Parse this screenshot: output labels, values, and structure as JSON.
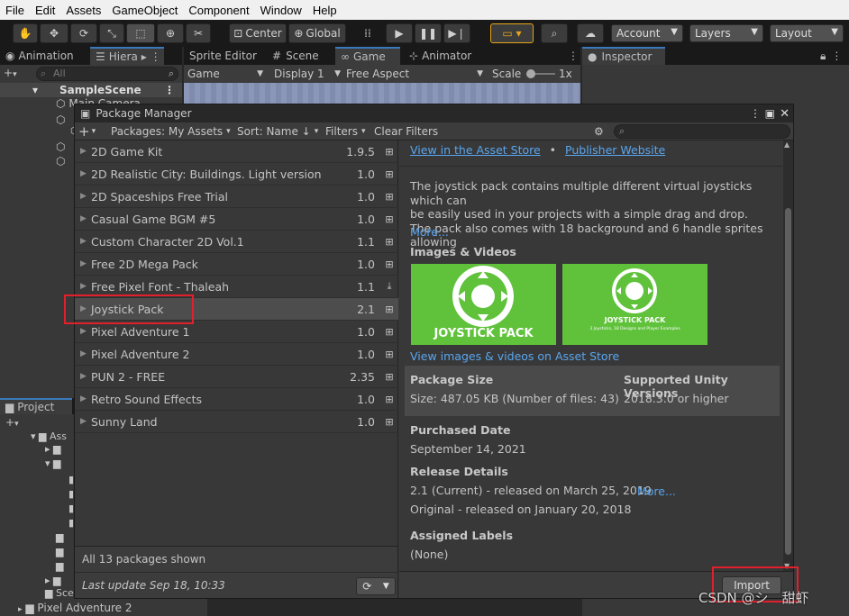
{
  "menu": [
    "File",
    "Edit",
    "Assets",
    "GameObject",
    "Component",
    "Window",
    "Help"
  ],
  "toolbar": {
    "center_label": "Center",
    "global_label": "Global",
    "account_label": "Account",
    "layers_label": "Layers",
    "layout_label": "Layout"
  },
  "left_tabs": {
    "animation": "Animation",
    "hierarchy": "Hiera"
  },
  "hierarchy": {
    "search_placeholder": "All",
    "scene_name": "SampleScene",
    "partial_item": "Main Camera"
  },
  "center_tabs": {
    "sprite_editor": "Sprite Editor",
    "scene": "Scene",
    "game": "Game",
    "animator": "Animator"
  },
  "game_bar": {
    "mode": "Game",
    "display": "Display 1",
    "aspect": "Free Aspect",
    "scale_label": "Scale",
    "scale_value": "1x"
  },
  "inspector_tab": "Inspector",
  "project": {
    "tab": "Project",
    "items": [
      "Ass",
      "",
      "",
      "",
      "Sce"
    ],
    "bottom_item": "Pixel Adventure 2"
  },
  "package_manager": {
    "title": "Package Manager",
    "packages_dropdown": "Packages: My Assets",
    "sort_dropdown": "Sort: Name ↓",
    "filters_dropdown": "Filters",
    "clear_filters": "Clear Filters",
    "packages": [
      {
        "name": "2D Game Kit",
        "version": "1.9.5",
        "status": "import"
      },
      {
        "name": "2D Realistic City: Buildings. Light version",
        "version": "1.0",
        "status": "import"
      },
      {
        "name": "2D Spaceships Free Trial",
        "version": "1.0",
        "status": "import"
      },
      {
        "name": "Casual Game BGM #5",
        "version": "1.0",
        "status": "import"
      },
      {
        "name": "Custom Character 2D Vol.1",
        "version": "1.1",
        "status": "import"
      },
      {
        "name": "Free 2D Mega Pack",
        "version": "1.0",
        "status": "import"
      },
      {
        "name": "Free Pixel Font - Thaleah",
        "version": "1.1",
        "status": "download"
      },
      {
        "name": "Joystick Pack",
        "version": "2.1",
        "status": "import"
      },
      {
        "name": "Pixel Adventure 1",
        "version": "1.0",
        "status": "import"
      },
      {
        "name": "Pixel Adventure 2",
        "version": "1.0",
        "status": "import"
      },
      {
        "name": "PUN 2 - FREE",
        "version": "2.35",
        "status": "import"
      },
      {
        "name": "Retro Sound Effects",
        "version": "1.0",
        "status": "import"
      },
      {
        "name": "Sunny Land",
        "version": "1.0",
        "status": "import"
      }
    ],
    "selected_index": 7,
    "packages_shown": "All 13 packages shown",
    "last_update": "Last update Sep 18, 10:33",
    "detail": {
      "view_store_link": "View in the Asset Store",
      "separator": "•",
      "publisher_link": "Publisher Website",
      "description_lines": [
        "The joystick pack contains multiple different virtual joysticks which can",
        "be easily used in your projects with a simple drag and drop.",
        "The pack also comes with 18 background and 6 handle sprites allowing"
      ],
      "more_link": "More...",
      "images_header": "Images & Videos",
      "thumb1_caption": "JOYSTICK PACK",
      "thumb2_caption": "JOYSTICK PACK",
      "thumb2_subcaption": "3 Joysticks, 18 Designs and Player Examples",
      "images_link": "View images & videos on Asset Store",
      "package_size_header": "Package Size",
      "package_size_value": "Size: 487.05 KB (Number of files: 43)",
      "supported_header": "Supported Unity Versions",
      "supported_value": "2018.3.0 or higher",
      "purchased_header": "Purchased Date",
      "purchased_value": "September 14, 2021",
      "release_header": "Release Details",
      "release_current": "2.1 (Current) - released on March 25, 2019",
      "release_more": "More...",
      "release_original": "Original - released on January 20, 2018",
      "labels_header": "Assigned Labels",
      "labels_value": "(None)",
      "import_button": "Import"
    }
  },
  "watermark": "CSDN @シ　甜虾",
  "colors": {
    "accent_blue": "#3a79bb",
    "link": "#59a6f0",
    "highlight_red": "#e0202a",
    "thumb_green": "#5fc23a"
  }
}
